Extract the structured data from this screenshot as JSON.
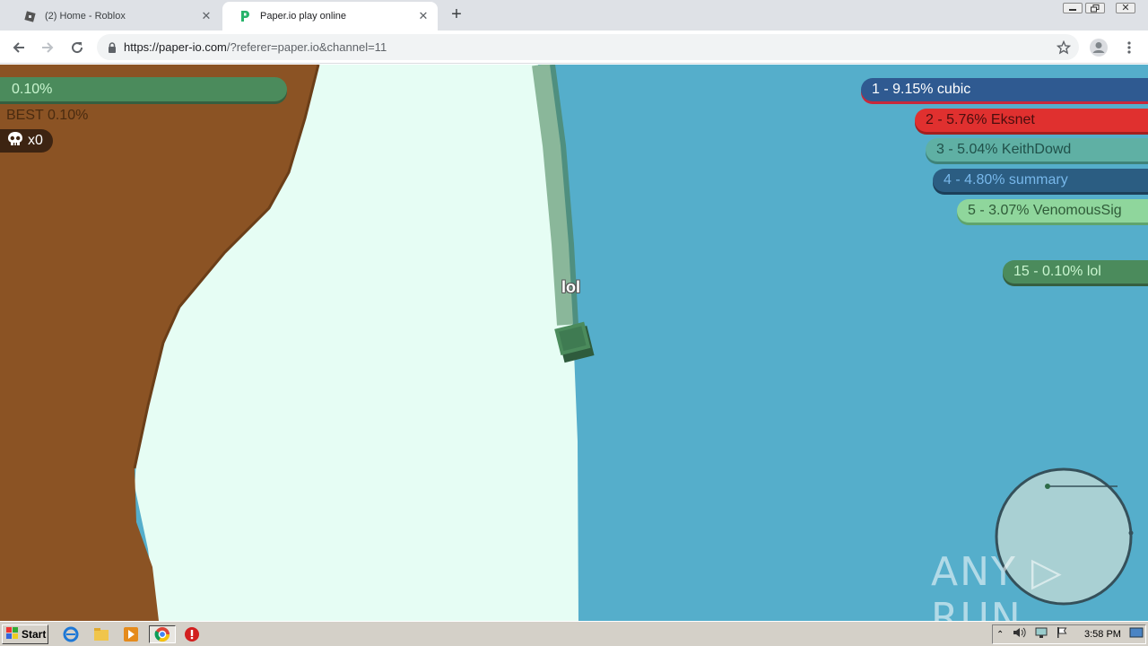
{
  "browser": {
    "tabs": [
      {
        "title": "(2) Home - Roblox",
        "active": false
      },
      {
        "title": "Paper.io play online",
        "active": true
      }
    ],
    "url_host": "https://paper-io.com",
    "url_rest": "/?referer=paper.io&channel=11"
  },
  "hud": {
    "percent": "0.10%",
    "best": "BEST 0.10%",
    "kills": "x0"
  },
  "leaderboard": [
    {
      "text": "1 - 9.15% cubic",
      "color": "#2f5a91"
    },
    {
      "text": "2 - 5.76% Eksnet",
      "color": "#e0302f"
    },
    {
      "text": "3 - 5.04% KeithDowd",
      "color": "#5fb0a4"
    },
    {
      "text": "4 - 4.80% summary",
      "color": "#2b5d82"
    },
    {
      "text": "5 - 3.07% VenomousSig",
      "color": "#8fd69c"
    }
  ],
  "my_rank": {
    "text": "15 - 0.10% lol",
    "color": "#4b8b5c"
  },
  "player": {
    "name": "lol"
  },
  "watermark": "ANY ▷ RUN",
  "taskbar": {
    "start_label": "Start",
    "clock": "3:58 PM"
  }
}
